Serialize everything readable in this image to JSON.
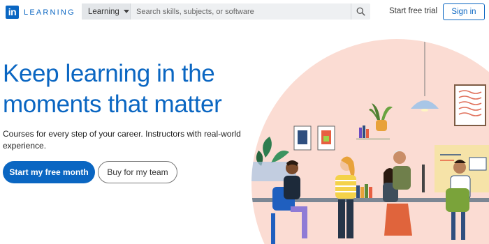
{
  "header": {
    "logo_mark": "in",
    "logo_word": "LEARNING",
    "search": {
      "category": "Learning",
      "placeholder": "Search skills, subjects, or software"
    },
    "start_trial": "Start free trial",
    "sign_in": "Sign in"
  },
  "hero": {
    "title": "Keep learning in the moments that matter",
    "subtitle": "Courses for every step of your career. Instructors with real-world experience.",
    "primary_cta": "Start my free month",
    "secondary_cta": "Buy for my team"
  },
  "colors": {
    "brand": "#0a66c2",
    "illustration_bg": "#fbdcd3"
  },
  "icons": [
    "linkedin-logo-icon",
    "chevron-down-icon",
    "search-icon"
  ]
}
